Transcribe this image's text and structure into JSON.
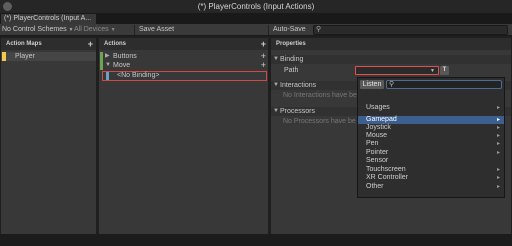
{
  "window": {
    "title": "(*) PlayerControls (Input Actions)"
  },
  "tab": {
    "label": "(*) PlayerControls (Input A..."
  },
  "toolbar": {
    "control_scheme": "No Control Schemes",
    "devices": "All Devices",
    "save_asset": "Save Asset",
    "auto_save": "Auto-Save",
    "search_placeholder": ""
  },
  "action_maps": {
    "header": "Action Maps",
    "items": [
      "Player"
    ]
  },
  "actions": {
    "header": "Actions",
    "items": [
      {
        "label": "Buttons"
      },
      {
        "label": "Move"
      },
      {
        "label": "<No Binding>"
      }
    ]
  },
  "properties": {
    "header": "Properties",
    "binding_section": "Binding",
    "path_label": "Path",
    "t_button": "T",
    "interactions_section": "Interactions",
    "interactions_empty": "No Interactions have be",
    "processors_section": "Processors",
    "processors_empty": "No Processors have be"
  },
  "popup": {
    "listen_label": "Listen",
    "items": [
      "Usages",
      "Gamepad",
      "Joystick",
      "Mouse",
      "Pen",
      "Pointer",
      "Sensor",
      "Touchscreen",
      "XR Controller",
      "Other"
    ],
    "selected": "Gamepad"
  },
  "colors": {
    "selection": "#3d5f8f",
    "highlight_outline": "#e05050",
    "accent_green": "#6ea44f",
    "player_marker": "#f2c94c"
  }
}
